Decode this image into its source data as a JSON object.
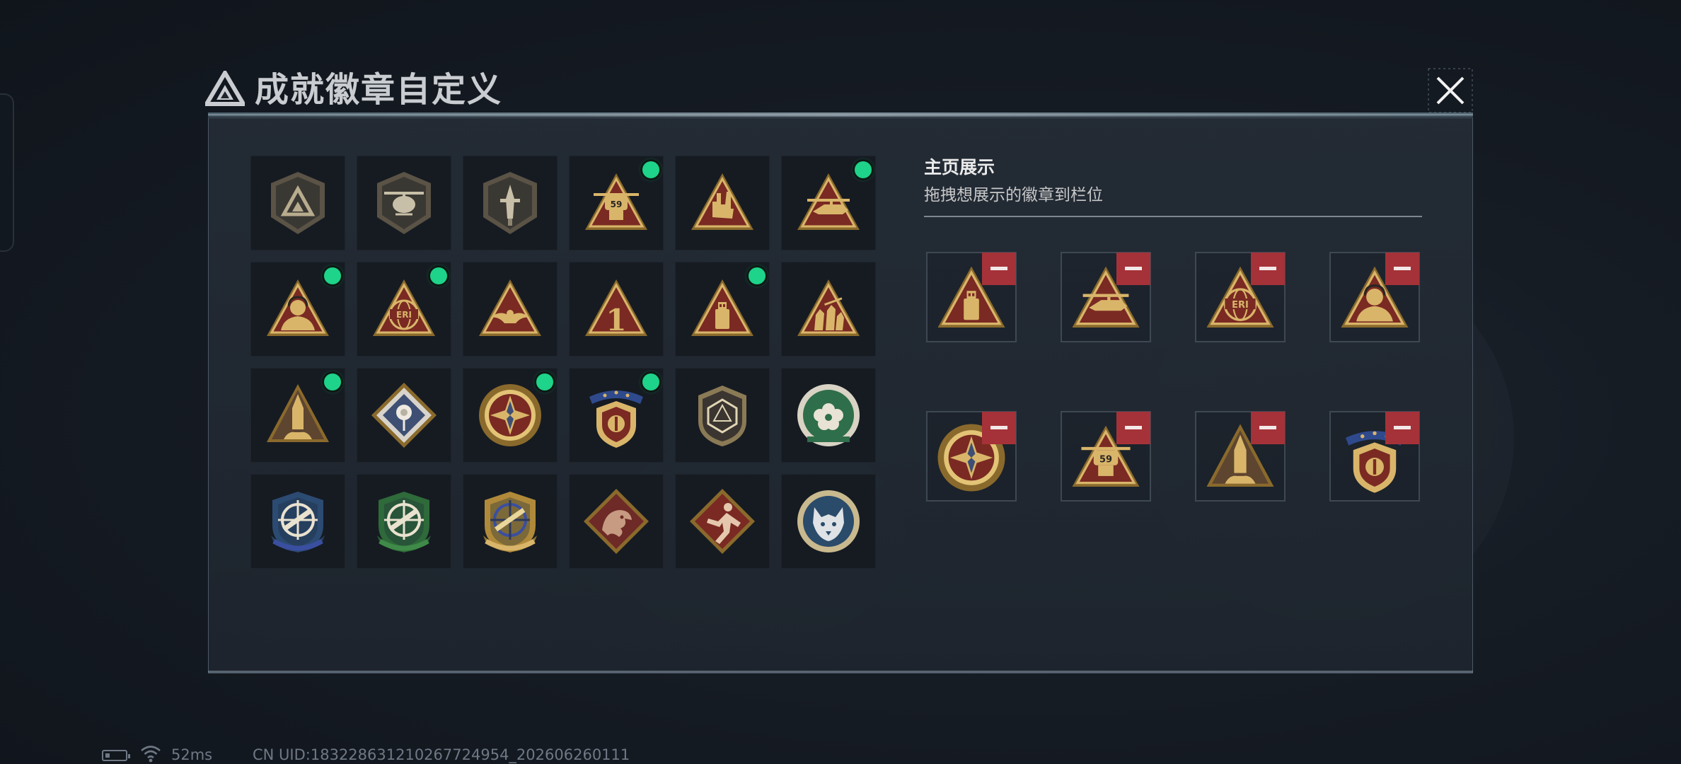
{
  "dialog": {
    "title": "成就徽章自定义",
    "close_icon": "close-x-icon"
  },
  "badge_grid": [
    {
      "icon": "triangle-logo-shield-badge",
      "active": false
    },
    {
      "icon": "helicopter-shield-badge",
      "active": false
    },
    {
      "icon": "dagger-shield-badge",
      "active": false
    },
    {
      "icon": "drone-59-triangle-badge",
      "active": true
    },
    {
      "icon": "hand-gesture-triangle-badge",
      "active": false
    },
    {
      "icon": "gunship-triangle-badge",
      "active": true
    },
    {
      "icon": "soldier-headset-triangle-badge",
      "active": true
    },
    {
      "icon": "eri-globe-triangle-badge",
      "active": true
    },
    {
      "icon": "eagle-triangle-badge",
      "active": false
    },
    {
      "icon": "number-one-triangle-badge",
      "active": false
    },
    {
      "icon": "usb-drive-triangle-badge",
      "active": true
    },
    {
      "icon": "soldiers-triangle-badge",
      "active": false
    },
    {
      "icon": "rocket-triangle-badge",
      "active": true
    },
    {
      "icon": "rose-diamond-badge",
      "active": false
    },
    {
      "icon": "compass-star-round-badge",
      "active": true
    },
    {
      "icon": "ribbon-stars-shield-badge",
      "active": true
    },
    {
      "icon": "d20-dice-shield-badge",
      "active": false
    },
    {
      "icon": "flower-round-badge",
      "active": false
    },
    {
      "icon": "crosshair-rifle-blue-badge",
      "active": false
    },
    {
      "icon": "crosshair-rifle-green-badge",
      "active": false
    },
    {
      "icon": "crosshair-rifle-gold-badge",
      "active": false
    },
    {
      "icon": "dragon-diamond-badge",
      "active": false
    },
    {
      "icon": "runner-diamond-badge",
      "active": false
    },
    {
      "icon": "wolf-round-badge",
      "active": false
    }
  ],
  "display": {
    "title": "主页展示",
    "subtitle": "拖拽想展示的徽章到栏位",
    "slots": [
      {
        "icon": "usb-drive-triangle-badge"
      },
      {
        "icon": "gunship-triangle-badge"
      },
      {
        "icon": "eri-globe-triangle-badge"
      },
      {
        "icon": "soldier-headset-triangle-badge"
      },
      {
        "icon": "compass-star-round-badge"
      },
      {
        "icon": "drone-59-triangle-badge"
      },
      {
        "icon": "rocket-triangle-badge"
      },
      {
        "icon": "ribbon-stars-shield-badge"
      }
    ],
    "remove_icon": "minus-icon"
  },
  "status": {
    "ping": "52ms",
    "uid": "CN UID:18322863121026772495​4_202606260111"
  },
  "badge_text": {
    "drone": "59",
    "eri": "ERI",
    "one": "1"
  }
}
